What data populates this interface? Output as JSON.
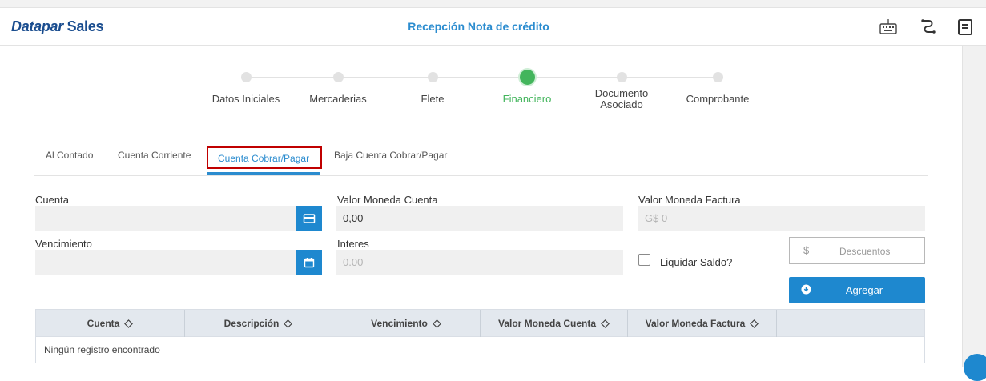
{
  "header": {
    "brand_part1": "Datapar",
    "brand_part2": "Sales",
    "title": "Recepción Nota de crédito",
    "icons": [
      "keyboard-icon",
      "route-icon",
      "document-icon"
    ]
  },
  "stepper": {
    "steps": [
      {
        "label": "Datos Iniciales",
        "active": false
      },
      {
        "label": "Mercaderias",
        "active": false
      },
      {
        "label": "Flete",
        "active": false
      },
      {
        "label": "Financiero",
        "active": true
      },
      {
        "label_line1": "Documento",
        "label_line2": "Asociado",
        "active": false
      },
      {
        "label": "Comprobante",
        "active": false
      }
    ],
    "active_color": "#43b55c"
  },
  "tabs": [
    {
      "label": "Al Contado",
      "active": false
    },
    {
      "label": "Cuenta Corriente",
      "active": false
    },
    {
      "label": "Cuenta Cobrar/Pagar",
      "active": true
    },
    {
      "label": "Baja Cuenta Cobrar/Pagar",
      "active": false
    }
  ],
  "form": {
    "cuenta": {
      "label": "Cuenta",
      "value": "",
      "button_icon": "card-icon"
    },
    "vencimiento": {
      "label": "Vencimiento",
      "value": "",
      "button_icon": "calendar-icon"
    },
    "valor_moneda_cuenta": {
      "label": "Valor Moneda Cuenta",
      "value": "0,00"
    },
    "interes": {
      "label": "Interes",
      "value": "0.00"
    },
    "valor_moneda_factura": {
      "label": "Valor Moneda Factura",
      "value": "G$ 0"
    },
    "liquidar_saldo": {
      "label": "Liquidar Saldo?",
      "checked": false
    },
    "descuentos": {
      "currency": "$",
      "placeholder": "Descuentos"
    },
    "agregar_label": "Agregar"
  },
  "table": {
    "columns": [
      "Cuenta",
      "Descripción",
      "Vencimiento",
      "Valor Moneda Cuenta",
      "Valor Moneda Factura"
    ],
    "empty_message": "Ningún registro encontrado"
  },
  "colors": {
    "accent": "#1e88cf",
    "highlight_border": "#c00000",
    "brand": "#1a4d8f"
  }
}
